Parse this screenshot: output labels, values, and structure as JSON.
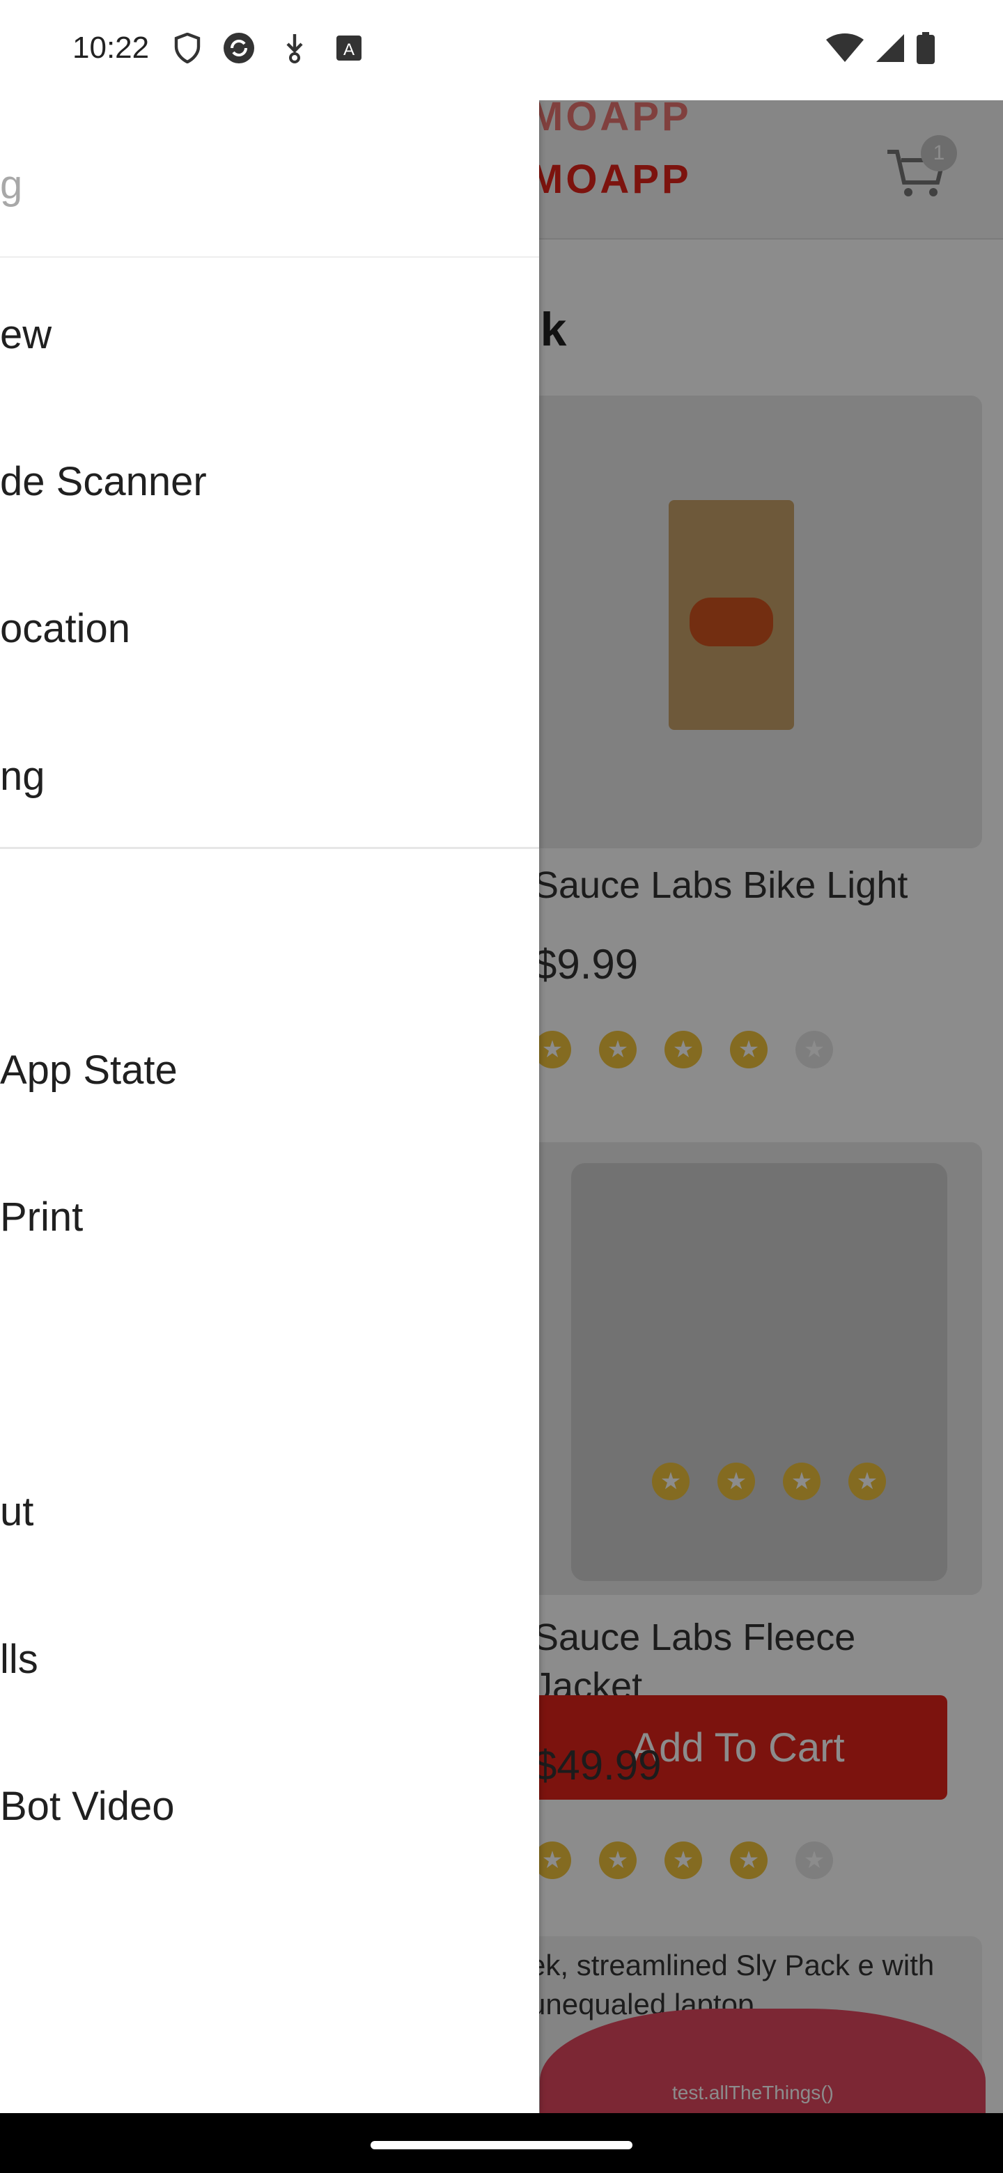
{
  "status_bar": {
    "time": "10:22",
    "icons": [
      "shield-icon",
      "sync-icon",
      "download-icon",
      "keyboard-icon"
    ],
    "right_icons": [
      "wifi-icon",
      "signal-icon",
      "battery-icon"
    ]
  },
  "drawer": {
    "header_text": "g",
    "items": [
      {
        "label": "ew"
      },
      {
        "label": "de Scanner"
      },
      {
        "label": "ocation"
      },
      {
        "label": "ng"
      },
      {
        "label": "App State"
      },
      {
        "label": "Print"
      },
      {
        "label": "ut"
      },
      {
        "label": "lls"
      },
      {
        "label": " Bot Video"
      }
    ]
  },
  "background_app": {
    "logo_text": "MOAPP",
    "cart_count": "1",
    "page_title": "ack",
    "products": [
      {
        "name": "Sauce Labs Bike Light",
        "price": "$9.99",
        "rating": 4
      },
      {
        "name_line1": "Sauce Labs Fleece",
        "name_line2": "Jacket",
        "price": "$49.99",
        "rating": 4
      }
    ],
    "add_to_cart": "Add To Cart",
    "description": "ek, streamlined Sly Pack e with unequaled laptop",
    "promo_text": "test.allTheThings()"
  },
  "colors": {
    "brand": "#e2231a",
    "star": "#f0c33c"
  }
}
